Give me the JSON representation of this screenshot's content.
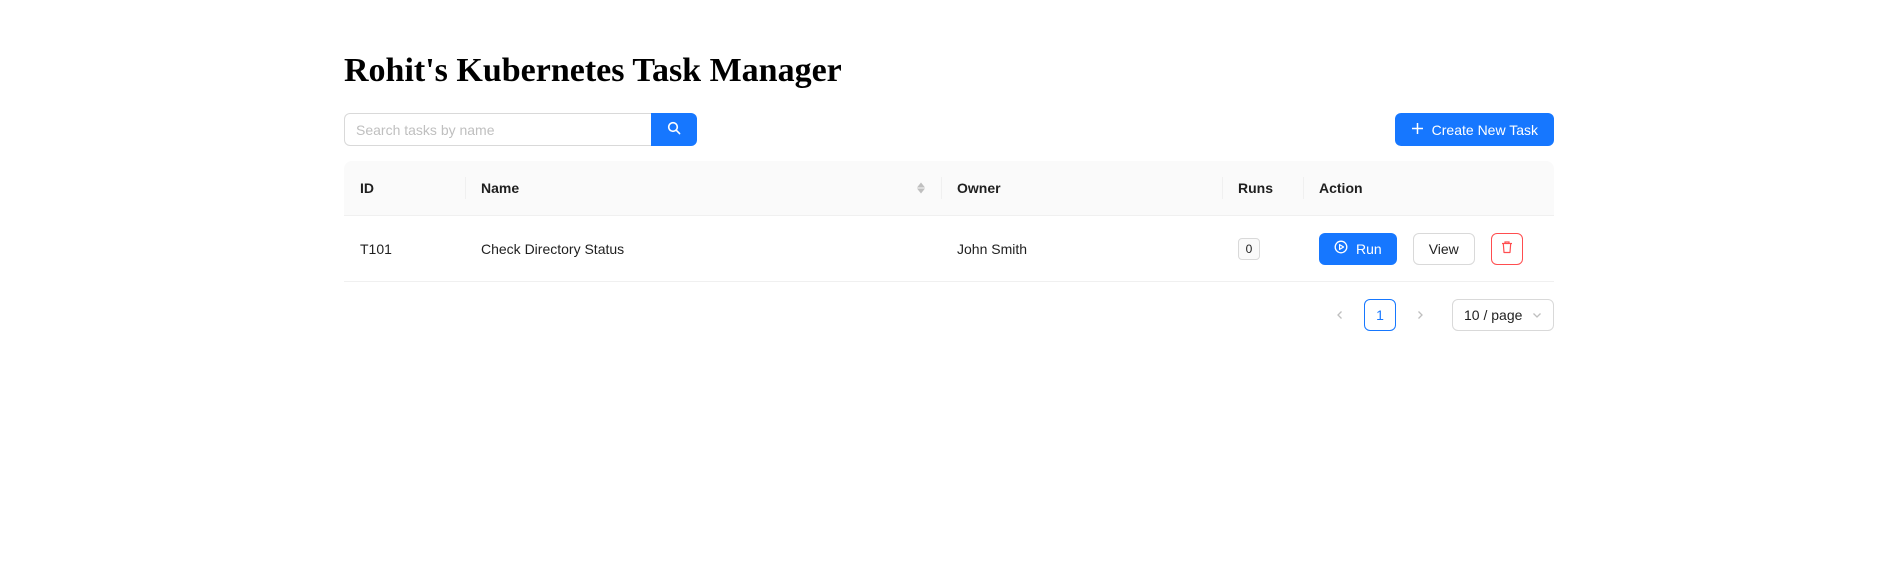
{
  "page": {
    "title": "Rohit's Kubernetes Task Manager"
  },
  "toolbar": {
    "search_placeholder": "Search tasks by name",
    "search_value": "",
    "search_icon": "search-icon",
    "create_label": "Create New Task",
    "create_icon": "plus-icon"
  },
  "table": {
    "columns": [
      "ID",
      "Name",
      "Owner",
      "Runs",
      "Action"
    ],
    "rows": [
      {
        "id": "T101",
        "name": "Check Directory Status",
        "owner": "John Smith",
        "runs": "0",
        "actions": {
          "run": "Run",
          "view": "View",
          "delete_icon": "trash-icon",
          "run_icon": "play-circle-icon"
        }
      }
    ]
  },
  "pagination": {
    "current_page": "1",
    "page_size": "10 / page",
    "prev_icon": "chevron-left-icon",
    "next_icon": "chevron-right-icon"
  },
  "colors": {
    "primary": "#1677ff",
    "danger": "#ff4d4f",
    "header_bg": "#fafafa",
    "border": "#d9d9d9"
  }
}
